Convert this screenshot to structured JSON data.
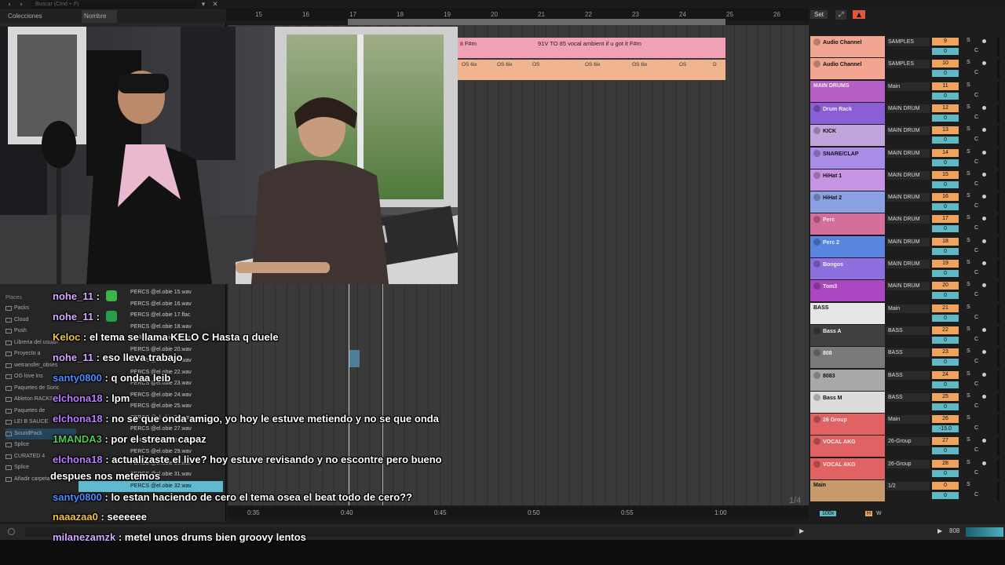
{
  "browser": {
    "search_placeholder": "Buscar (Cmd + F)",
    "header_col1": "Colecciones",
    "header_col2": "Nombre",
    "places_title": "Places",
    "places": [
      "Packs",
      "Cloud",
      "Push",
      "Libreria del usuari",
      "Proyecto a",
      "wetransfer_obses",
      "OG love ins",
      "Paquetes de Soric",
      "Ableton RACKS",
      "Paquetes de",
      "LEI B SAUCE",
      "SoundPack",
      "Splice",
      "CURATED 4",
      "Splice",
      "Añadir carpeta..."
    ],
    "selected_place_index": 11,
    "files": [
      "PERCS @el.obie 15.wav",
      "PERCS @el.obie 16.wav",
      "PERCS @el.obie 17.flac",
      "PERCS @el.obie 18.wav",
      "PERCS @el.obie 19.wav",
      "PERCS @el.obie 20.wav",
      "PERCS @el.obie 21.wav",
      "PERCS @el.obie 22.wav",
      "PERCS @el.obie 23.wav",
      "PERCS @el.obie 24.wav",
      "PERCS @el.obie 25.wav",
      "PERCS @el.obie 26.wav",
      "PERCS @el.obie 27.wav",
      "PERCS @el.obie 28.wav",
      "PERCS @el.obie 29.wav",
      "PERCS @el.obie 30.wav",
      "PERCS @el.obie 31.wav",
      "PERCS @el.obie 32.wav"
    ],
    "selected_file_index": 17
  },
  "ruler": {
    "bars": [
      "15",
      "16",
      "17",
      "18",
      "19",
      "20",
      "21",
      "22",
      "23",
      "24",
      "25",
      "26"
    ]
  },
  "clips": {
    "vocal_label_1": "it F#m",
    "vocal_label_2": "91V TO 85 vocal ambient if u got it F#m",
    "drum_labels": [
      "OS 6ix",
      "OS 6ix",
      "OS",
      "OS 6ix",
      "OS 6ix",
      "OS",
      "D"
    ]
  },
  "time_ruler": {
    "labels": [
      "0:35",
      "0:40",
      "0:45",
      "0:50",
      "0:55",
      "1:00"
    ]
  },
  "page_indicator": "1/4",
  "mixer": {
    "set_label": "Set",
    "fold_icon": "⤢",
    "rec_icon": "▲",
    "tracks": [
      {
        "name": "Audio Channel",
        "input": "SAMPLES",
        "num": "9",
        "vol": "0",
        "color": "#f2a590",
        "fold": true,
        "dot": true
      },
      {
        "name": "Audio Channel",
        "input": "SAMPLES",
        "num": "10",
        "vol": "0",
        "color": "#f2a590",
        "fold": true,
        "dot": true
      },
      {
        "name": "MAIN DRUMS",
        "input": "Main",
        "num": "11",
        "vol": "0",
        "color": "#b65fc6",
        "fold": false,
        "dot": false
      },
      {
        "name": "Drum Rack",
        "input": "MAIN DRUM",
        "num": "12",
        "vol": "0",
        "color": "#8a5ed6",
        "fold": true,
        "dot": true
      },
      {
        "name": "KICK",
        "input": "MAIN DRUM",
        "num": "13",
        "vol": "0",
        "color": "#c1a4dc",
        "fold": true,
        "dot": true
      },
      {
        "name": "SNARE/CLAP",
        "input": "MAIN DRUM",
        "num": "14",
        "vol": "0",
        "color": "#a98be8",
        "fold": true,
        "dot": true
      },
      {
        "name": "HiHat 1",
        "input": "MAIN DRUM",
        "num": "15",
        "vol": "0",
        "color": "#c694e3",
        "fold": true,
        "dot": true
      },
      {
        "name": "HiHat 2",
        "input": "MAIN DRUM",
        "num": "16",
        "vol": "0",
        "color": "#8ba1e3",
        "fold": true,
        "dot": true
      },
      {
        "name": "Perc",
        "input": "MAIN DRUM",
        "num": "17",
        "vol": "0",
        "color": "#d46f9b",
        "fold": true,
        "dot": true
      },
      {
        "name": "Perc 2",
        "input": "MAIN DRUM",
        "num": "18",
        "vol": "0",
        "color": "#5b86e0",
        "fold": true,
        "dot": true
      },
      {
        "name": "Bongos",
        "input": "MAIN DRUM",
        "num": "19",
        "vol": "0",
        "color": "#8e6fe0",
        "fold": true,
        "dot": true
      },
      {
        "name": "Tom3",
        "input": "MAIN DRUM",
        "num": "20",
        "vol": "0",
        "color": "#ab47c0",
        "fold": true,
        "dot": true
      },
      {
        "name": "BASS",
        "input": "Main",
        "num": "21",
        "vol": "0",
        "color": "#e6e6e6",
        "fold": false,
        "dot": false
      },
      {
        "name": "Bass A",
        "input": "BASS",
        "num": "22",
        "vol": "0",
        "color": "#404040",
        "fold": true,
        "dot": true
      },
      {
        "name": "808",
        "input": "BASS",
        "num": "23",
        "vol": "0",
        "color": "#7a7a7a",
        "fold": true,
        "dot": true
      },
      {
        "name": "8083",
        "input": "BASS",
        "num": "24",
        "vol": "0",
        "color": "#a8a8a8",
        "fold": true,
        "dot": true
      },
      {
        "name": "Bass M",
        "input": "BASS",
        "num": "25",
        "vol": "0",
        "color": "#dcdcdc",
        "fold": true,
        "dot": true
      },
      {
        "name": "26 Group",
        "input": "Main",
        "num": "26",
        "vol": "-15.0",
        "color": "#e06262",
        "fold": true,
        "dot": false
      },
      {
        "name": "VOCAL AKG",
        "input": "26-Group",
        "num": "27",
        "vol": "0",
        "color": "#e06262",
        "fold": true,
        "dot": true
      },
      {
        "name": "VOCAL AKG",
        "input": "26-Group",
        "num": "28",
        "vol": "0",
        "color": "#e06262",
        "fold": true,
        "dot": true
      },
      {
        "name": "Main",
        "input": "1/2",
        "input2": "1/2",
        "num": "0",
        "vol": "0",
        "color": "#c79a6b",
        "fold": false,
        "dot": false
      }
    ],
    "zoom_value": "100x",
    "h_label": "H",
    "w_label": "W",
    "solo_label": "S",
    "cue_label": "C"
  },
  "transport": {
    "track_name": "808",
    "play_icon": "▶"
  },
  "chat": [
    {
      "user": "nohe_11",
      "color": "#d6a8ff",
      "text": " : ",
      "emote": "#3bb44a"
    },
    {
      "user": "nohe_11",
      "color": "#d6a8ff",
      "text": " : ",
      "emote": "#2a9d4a"
    },
    {
      "user": "Keloc",
      "color": "#f0c24a",
      "text": " : el tema se llama KELO C Hasta q duele"
    },
    {
      "user": "nohe_11",
      "color": "#d6a8ff",
      "text": " : eso lleva trabajo"
    },
    {
      "user": "santy0800",
      "color": "#4a8cff",
      "text": " : q ondaa leib"
    },
    {
      "user": "elchona18",
      "color": "#b77cff",
      "text": " : lpm"
    },
    {
      "user": "elchona18",
      "color": "#b77cff",
      "text": " : no se que onda amigo, yo hoy le estuve metiendo y no se que onda"
    },
    {
      "user": "1MANDA3",
      "color": "#4ecb4e",
      "text": " : por el stream capaz"
    },
    {
      "user": "elchona18",
      "color": "#b77cff",
      "text": " : actualizaste el live? hoy estuve revisando y no escontre pero bueno"
    },
    {
      "user": "",
      "color": "#fff",
      "text": "despues nos metemos"
    },
    {
      "user": "santy0800",
      "color": "#4a8cff",
      "text": " : lo estan haciendo de cero el tema osea el beat todo de cero??"
    },
    {
      "user": "naaazaa0",
      "color": "#f0c24a",
      "text": " : seeeeee"
    },
    {
      "user": "milanezamzk",
      "color": "#d6a8ff",
      "text": " : metel unos drums bien groovy lentos"
    }
  ]
}
